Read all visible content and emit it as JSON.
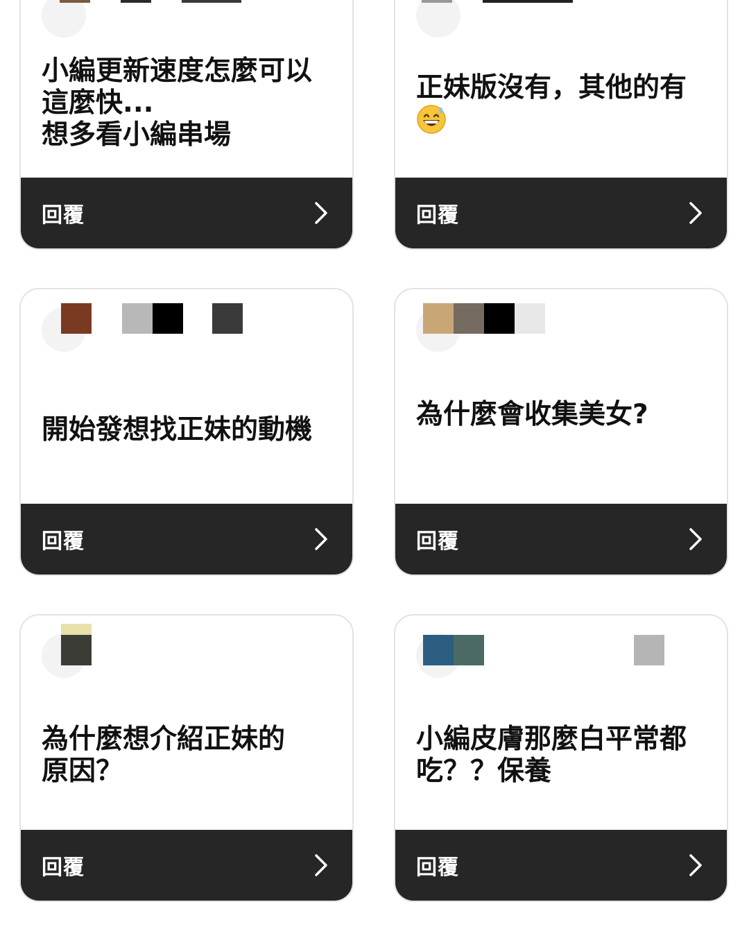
{
  "reply_label": "回覆",
  "colors": {
    "card_border": "#e3e3e3",
    "reply_bar": "#262626",
    "text": "#111111"
  },
  "cards": [
    {
      "question": "小編更新速度怎麼可以\n這麼快...\n想多看小編串場",
      "avatar_swatches": [
        "#7a5a40",
        "#2a2a2a",
        "#3a3a3a"
      ]
    },
    {
      "question": "正妹版沒有，其他的有",
      "emoji": "grinning-face-with-sweat",
      "avatar_swatches": [
        "#999999",
        "#222222"
      ]
    },
    {
      "question": "開始發想找正妹的動機",
      "avatar_swatches": [
        "#7a3a22",
        "#b8b8b8",
        "#000000",
        "#3a3a3a"
      ]
    },
    {
      "question": "為什麼會收集美女?",
      "avatar_swatches": [
        "#c9a676",
        "#766b61",
        "#000000",
        "#e8e8e8"
      ]
    },
    {
      "question": "為什麼想介紹正妹的\n原因？",
      "avatar_swatches": [
        "#e8e0a8",
        "#3c3c36"
      ]
    },
    {
      "question": "小編皮膚那麼白平常都\n吃？？保養",
      "avatar_swatches": [
        "#2b5e80",
        "#4c6a65",
        "#b5b5b5"
      ]
    }
  ]
}
